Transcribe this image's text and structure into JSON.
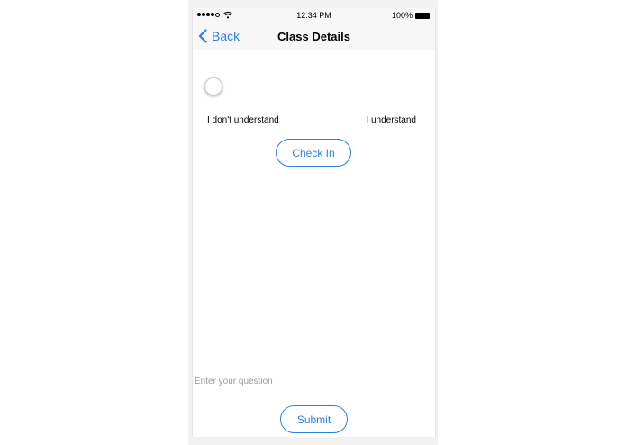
{
  "status_bar": {
    "time": "12:34 PM",
    "battery": "100%"
  },
  "nav": {
    "back_label": "Back",
    "title": "Class Details"
  },
  "slider": {
    "value": 0,
    "min_label": "I don't understand",
    "max_label": "I understand"
  },
  "check_in": {
    "label": "Check In"
  },
  "question": {
    "placeholder": "Enter your question",
    "value": ""
  },
  "submit": {
    "label": "Submit"
  },
  "colors": {
    "accent": "#2f7fe0",
    "nav_background": "#f7f7f8"
  },
  "icons": {
    "signal": "signal-dots-icon",
    "wifi": "wifi-icon",
    "battery": "battery-icon",
    "back": "chevron-left-icon"
  }
}
